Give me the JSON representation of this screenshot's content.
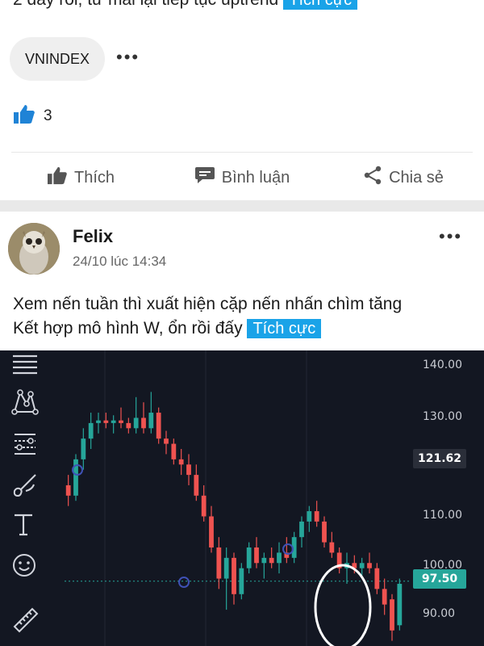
{
  "previous_post": {
    "text_tail": "2 đây rồi, từ mai lại tiếp tục uptrend",
    "sentiment_tag": "Tích cực",
    "ticker_chip": "VNINDEX",
    "like_count": "3"
  },
  "actions": {
    "like": "Thích",
    "comment": "Bình luận",
    "share": "Chia sẻ"
  },
  "post": {
    "author": "Felix",
    "timestamp": "24/10 lúc 14:34",
    "line1": "Xem nến tuần thì xuất hiện cặp nến nhấn chìm tăng",
    "line2": "Kết hợp mô hình W, ổn rồi đấy",
    "sentiment_tag": "Tích cực"
  },
  "chart": {
    "axis_labels": [
      "140.00",
      "130.00",
      "110.00",
      "100.00",
      "90.00"
    ],
    "current_price": "121.62",
    "marker_price": "97.50",
    "tools": [
      "menu-lines-icon",
      "pattern-icon",
      "fib-icon",
      "brush-icon",
      "text-tool-icon",
      "emoji-icon",
      "ruler-icon"
    ]
  },
  "colors": {
    "accent": "#1aa3e8",
    "up_candle": "#26a69a",
    "down_candle": "#ef5350",
    "chart_bg": "#131722"
  },
  "chart_data": {
    "type": "candlestick",
    "ylim": [
      85,
      142
    ],
    "candles": [
      {
        "o": 116,
        "h": 118,
        "l": 112,
        "c": 114
      },
      {
        "o": 114,
        "h": 122,
        "l": 113,
        "c": 121
      },
      {
        "o": 121,
        "h": 127,
        "l": 119,
        "c": 125
      },
      {
        "o": 125,
        "h": 130,
        "l": 123,
        "c": 128
      },
      {
        "o": 128,
        "h": 130,
        "l": 126,
        "c": 128.5
      },
      {
        "o": 128.5,
        "h": 130,
        "l": 127,
        "c": 128
      },
      {
        "o": 128,
        "h": 129.5,
        "l": 126,
        "c": 128.5
      },
      {
        "o": 128.5,
        "h": 131,
        "l": 127,
        "c": 128
      },
      {
        "o": 128,
        "h": 129,
        "l": 126,
        "c": 127
      },
      {
        "o": 127,
        "h": 133,
        "l": 126,
        "c": 129
      },
      {
        "o": 129,
        "h": 132,
        "l": 126,
        "c": 127
      },
      {
        "o": 127,
        "h": 134,
        "l": 126,
        "c": 130
      },
      {
        "o": 130,
        "h": 131,
        "l": 124,
        "c": 125
      },
      {
        "o": 125,
        "h": 126.5,
        "l": 122,
        "c": 124
      },
      {
        "o": 124,
        "h": 125,
        "l": 120,
        "c": 121
      },
      {
        "o": 121,
        "h": 123,
        "l": 118,
        "c": 120
      },
      {
        "o": 120,
        "h": 122,
        "l": 116,
        "c": 118
      },
      {
        "o": 118,
        "h": 120,
        "l": 113,
        "c": 114
      },
      {
        "o": 114,
        "h": 116,
        "l": 109,
        "c": 110
      },
      {
        "o": 110,
        "h": 112,
        "l": 103,
        "c": 104
      },
      {
        "o": 104,
        "h": 106,
        "l": 96,
        "c": 98
      },
      {
        "o": 98,
        "h": 104,
        "l": 92,
        "c": 102
      },
      {
        "o": 102,
        "h": 103,
        "l": 93,
        "c": 95
      },
      {
        "o": 95,
        "h": 101,
        "l": 94,
        "c": 100
      },
      {
        "o": 100,
        "h": 105,
        "l": 99,
        "c": 104
      },
      {
        "o": 104,
        "h": 106,
        "l": 100,
        "c": 101
      },
      {
        "o": 101,
        "h": 103,
        "l": 98,
        "c": 102
      },
      {
        "o": 102,
        "h": 104,
        "l": 100,
        "c": 101
      },
      {
        "o": 101,
        "h": 105,
        "l": 99,
        "c": 103
      },
      {
        "o": 103,
        "h": 106,
        "l": 101,
        "c": 102
      },
      {
        "o": 102,
        "h": 107,
        "l": 101,
        "c": 106
      },
      {
        "o": 106,
        "h": 110,
        "l": 104,
        "c": 109
      },
      {
        "o": 109,
        "h": 112,
        "l": 107,
        "c": 111
      },
      {
        "o": 111,
        "h": 113,
        "l": 108,
        "c": 109
      },
      {
        "o": 109,
        "h": 110,
        "l": 104,
        "c": 105
      },
      {
        "o": 105,
        "h": 107,
        "l": 102,
        "c": 103
      },
      {
        "o": 103,
        "h": 104,
        "l": 99,
        "c": 100
      },
      {
        "o": 100,
        "h": 103,
        "l": 97,
        "c": 101
      },
      {
        "o": 101,
        "h": 102.5,
        "l": 99,
        "c": 100
      },
      {
        "o": 100,
        "h": 102,
        "l": 98,
        "c": 101
      },
      {
        "o": 101,
        "h": 103,
        "l": 99,
        "c": 100
      },
      {
        "o": 100,
        "h": 101,
        "l": 95,
        "c": 96
      },
      {
        "o": 96,
        "h": 98,
        "l": 91,
        "c": 93
      },
      {
        "o": 94,
        "h": 95,
        "l": 86,
        "c": 88
      },
      {
        "o": 89,
        "h": 98,
        "l": 88,
        "c": 97
      }
    ]
  }
}
